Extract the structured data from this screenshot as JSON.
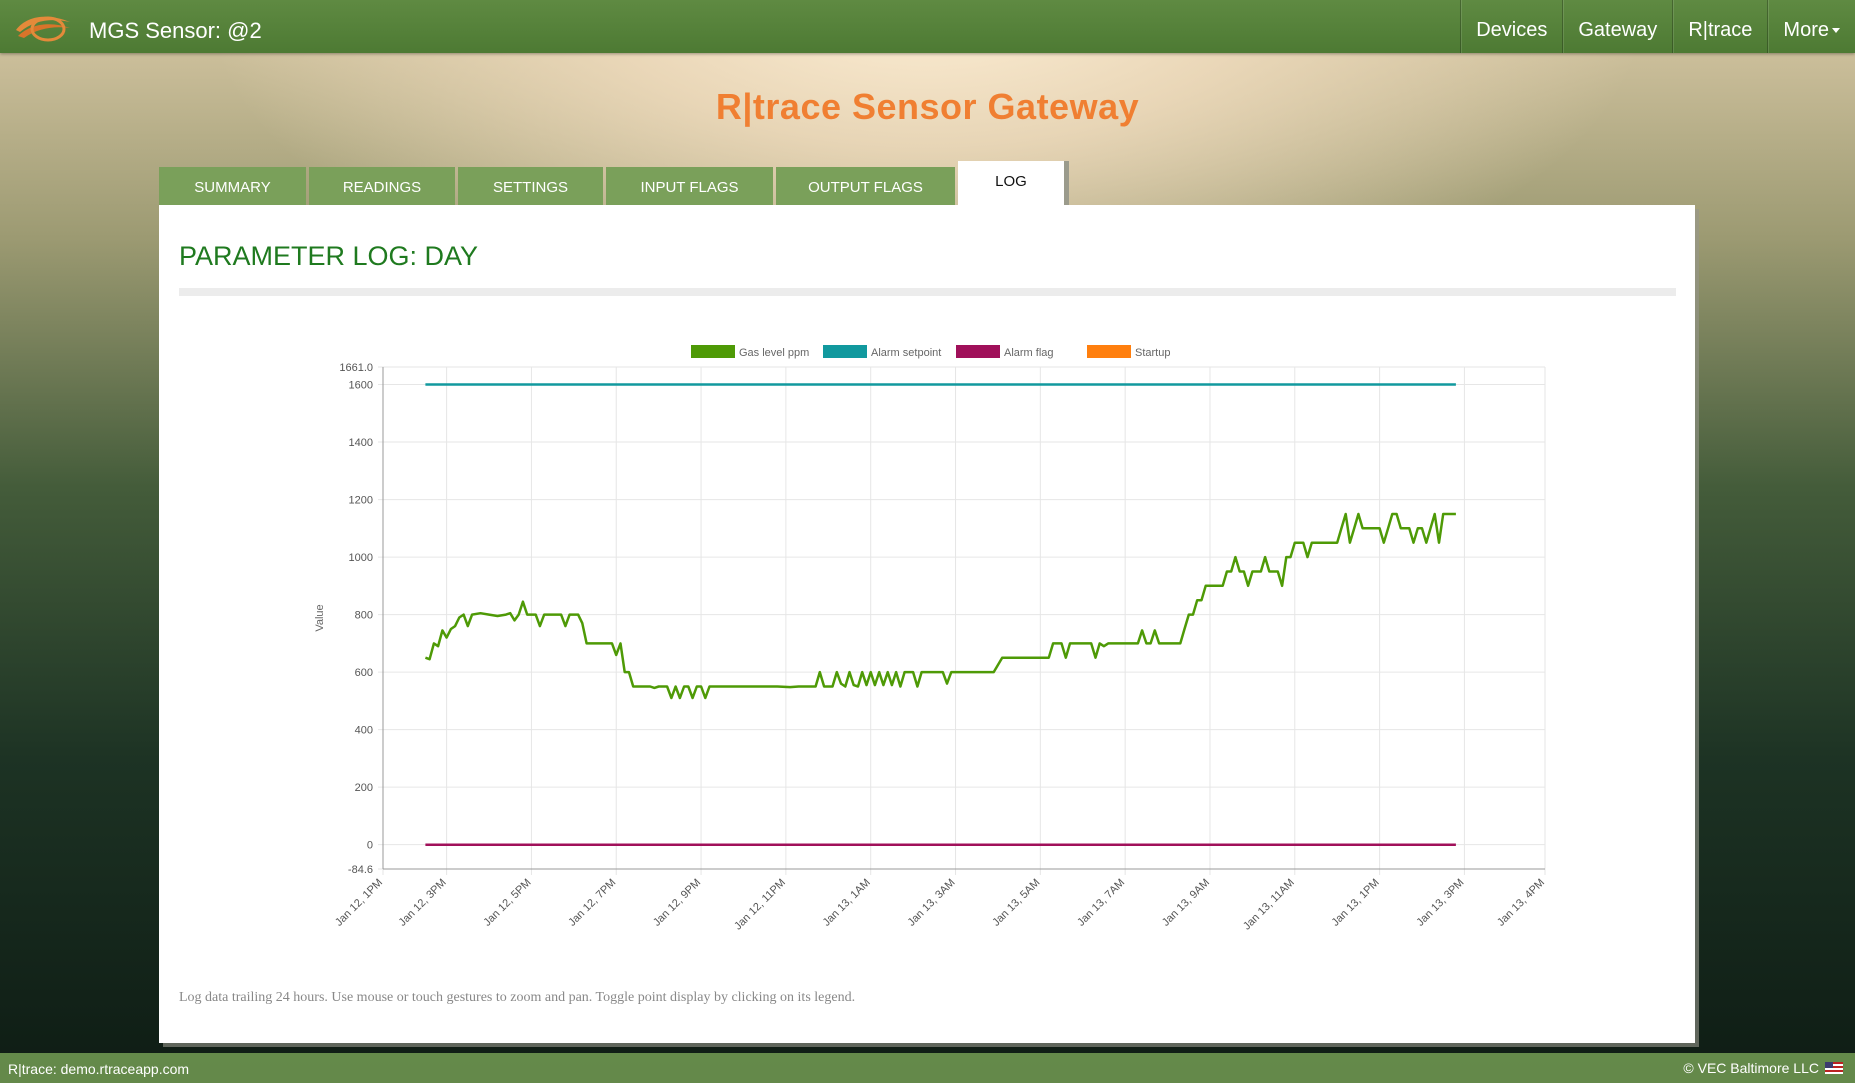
{
  "app": {
    "title": "MGS Sensor: @2",
    "nav": [
      {
        "label": "Devices"
      },
      {
        "label": "Gateway"
      },
      {
        "label": "R|trace"
      },
      {
        "label": "More"
      }
    ]
  },
  "page": {
    "heading": "R|trace Sensor Gateway",
    "tabs": [
      {
        "label": "SUMMARY",
        "active": false
      },
      {
        "label": "READINGS",
        "active": false
      },
      {
        "label": "SETTINGS",
        "active": false
      },
      {
        "label": "INPUT FLAGS",
        "active": false
      },
      {
        "label": "OUTPUT FLAGS",
        "active": false
      },
      {
        "label": "LOG",
        "active": true
      }
    ],
    "panel_title": "PARAMETER LOG: DAY",
    "footnote": "Log data trailing 24 hours. Use mouse or touch gestures to zoom and pan. Toggle point display by clicking on its legend."
  },
  "footer": {
    "left": "R|trace: demo.rtraceapp.com",
    "right": "© VEC Baltimore LLC"
  },
  "chart_data": {
    "type": "line",
    "ylabel": "Value",
    "ylim": [
      -84.6,
      1661.0
    ],
    "y_ticks": [
      {
        "value": 1661.0,
        "label": "1661.0"
      },
      {
        "value": 1600,
        "label": "1600"
      },
      {
        "value": 1400,
        "label": "1400"
      },
      {
        "value": 1200,
        "label": "1200"
      },
      {
        "value": 1000,
        "label": "1000"
      },
      {
        "value": 800,
        "label": "800"
      },
      {
        "value": 600,
        "label": "600"
      },
      {
        "value": 400,
        "label": "400"
      },
      {
        "value": 200,
        "label": "200"
      },
      {
        "value": 0,
        "label": "0"
      },
      {
        "value": -84.6,
        "label": "-84.6"
      }
    ],
    "x_ticks": [
      "Jan 12, 1PM",
      "Jan 12, 3PM",
      "Jan 12, 5PM",
      "Jan 12, 7PM",
      "Jan 12, 9PM",
      "Jan 12, 11PM",
      "Jan 13, 1AM",
      "Jan 13, 3AM",
      "Jan 13, 5AM",
      "Jan 13, 7AM",
      "Jan 13, 9AM",
      "Jan 13, 11AM",
      "Jan 13, 1PM",
      "Jan 13, 3PM",
      "Jan 13, 4PM"
    ],
    "x_tick_hours": [
      0,
      1.5,
      3.5,
      5.5,
      7.5,
      9.5,
      11.5,
      13.5,
      15.5,
      17.5,
      19.5,
      21.5,
      23.5,
      25.5,
      27.4
    ],
    "x_range_hours": [
      0,
      27.4
    ],
    "legend_position": "top-center",
    "grid": true,
    "series": [
      {
        "name": "Gas level ppm",
        "color": "#4e9a06",
        "points": [
          [
            1.0,
            650
          ],
          [
            1.1,
            645
          ],
          [
            1.2,
            700
          ],
          [
            1.3,
            690
          ],
          [
            1.4,
            745
          ],
          [
            1.5,
            720
          ],
          [
            1.6,
            750
          ],
          [
            1.7,
            760
          ],
          [
            1.8,
            790
          ],
          [
            1.9,
            800
          ],
          [
            2.0,
            760
          ],
          [
            2.1,
            800
          ],
          [
            2.3,
            805
          ],
          [
            2.5,
            800
          ],
          [
            2.7,
            795
          ],
          [
            2.9,
            800
          ],
          [
            3.0,
            805
          ],
          [
            3.1,
            780
          ],
          [
            3.2,
            800
          ],
          [
            3.3,
            845
          ],
          [
            3.4,
            800
          ],
          [
            3.6,
            800
          ],
          [
            3.7,
            760
          ],
          [
            3.8,
            800
          ],
          [
            4.0,
            800
          ],
          [
            4.2,
            800
          ],
          [
            4.3,
            760
          ],
          [
            4.4,
            800
          ],
          [
            4.6,
            800
          ],
          [
            4.7,
            770
          ],
          [
            4.8,
            700
          ],
          [
            5.0,
            700
          ],
          [
            5.2,
            700
          ],
          [
            5.4,
            700
          ],
          [
            5.5,
            660
          ],
          [
            5.6,
            700
          ],
          [
            5.7,
            600
          ],
          [
            5.8,
            600
          ],
          [
            5.9,
            550
          ],
          [
            6.1,
            550
          ],
          [
            6.3,
            550
          ],
          [
            6.4,
            545
          ],
          [
            6.5,
            550
          ],
          [
            6.7,
            550
          ],
          [
            6.8,
            510
          ],
          [
            6.9,
            550
          ],
          [
            7.0,
            510
          ],
          [
            7.1,
            550
          ],
          [
            7.2,
            550
          ],
          [
            7.3,
            510
          ],
          [
            7.4,
            550
          ],
          [
            7.5,
            550
          ],
          [
            7.6,
            510
          ],
          [
            7.7,
            550
          ],
          [
            7.8,
            550
          ],
          [
            8.0,
            550
          ],
          [
            8.3,
            550
          ],
          [
            8.6,
            550
          ],
          [
            9.0,
            550
          ],
          [
            9.3,
            550
          ],
          [
            9.6,
            548
          ],
          [
            9.8,
            550
          ],
          [
            10.0,
            550
          ],
          [
            10.2,
            550
          ],
          [
            10.3,
            600
          ],
          [
            10.4,
            550
          ],
          [
            10.6,
            550
          ],
          [
            10.7,
            600
          ],
          [
            10.8,
            560
          ],
          [
            10.9,
            550
          ],
          [
            11.0,
            600
          ],
          [
            11.1,
            555
          ],
          [
            11.2,
            550
          ],
          [
            11.3,
            600
          ],
          [
            11.4,
            555
          ],
          [
            11.5,
            600
          ],
          [
            11.6,
            555
          ],
          [
            11.7,
            600
          ],
          [
            11.8,
            555
          ],
          [
            11.9,
            600
          ],
          [
            12.0,
            555
          ],
          [
            12.1,
            600
          ],
          [
            12.2,
            550
          ],
          [
            12.3,
            600
          ],
          [
            12.5,
            600
          ],
          [
            12.6,
            550
          ],
          [
            12.7,
            600
          ],
          [
            12.9,
            600
          ],
          [
            13.1,
            600
          ],
          [
            13.2,
            600
          ],
          [
            13.3,
            560
          ],
          [
            13.4,
            600
          ],
          [
            13.6,
            600
          ],
          [
            13.9,
            600
          ],
          [
            14.2,
            600
          ],
          [
            14.4,
            600
          ],
          [
            14.6,
            650
          ],
          [
            14.9,
            650
          ],
          [
            15.2,
            650
          ],
          [
            15.6,
            650
          ],
          [
            15.7,
            650
          ],
          [
            15.8,
            700
          ],
          [
            16.0,
            700
          ],
          [
            16.1,
            650
          ],
          [
            16.2,
            700
          ],
          [
            16.5,
            700
          ],
          [
            16.7,
            700
          ],
          [
            16.8,
            650
          ],
          [
            16.9,
            700
          ],
          [
            17.0,
            690
          ],
          [
            17.1,
            700
          ],
          [
            17.4,
            700
          ],
          [
            17.7,
            700
          ],
          [
            17.8,
            700
          ],
          [
            17.9,
            745
          ],
          [
            18.0,
            700
          ],
          [
            18.1,
            700
          ],
          [
            18.2,
            745
          ],
          [
            18.3,
            700
          ],
          [
            18.5,
            700
          ],
          [
            18.8,
            700
          ],
          [
            18.9,
            750
          ],
          [
            19.0,
            800
          ],
          [
            19.1,
            800
          ],
          [
            19.2,
            850
          ],
          [
            19.3,
            850
          ],
          [
            19.4,
            900
          ],
          [
            19.6,
            900
          ],
          [
            19.8,
            900
          ],
          [
            19.9,
            950
          ],
          [
            20.0,
            950
          ],
          [
            20.1,
            1000
          ],
          [
            20.2,
            950
          ],
          [
            20.3,
            950
          ],
          [
            20.4,
            900
          ],
          [
            20.5,
            950
          ],
          [
            20.7,
            950
          ],
          [
            20.8,
            1000
          ],
          [
            20.9,
            950
          ],
          [
            21.0,
            950
          ],
          [
            21.1,
            950
          ],
          [
            21.2,
            900
          ],
          [
            21.3,
            1000
          ],
          [
            21.4,
            1000
          ],
          [
            21.5,
            1050
          ],
          [
            21.7,
            1050
          ],
          [
            21.8,
            1000
          ],
          [
            21.9,
            1050
          ],
          [
            22.1,
            1050
          ],
          [
            22.4,
            1050
          ],
          [
            22.5,
            1050
          ],
          [
            22.6,
            1100
          ],
          [
            22.7,
            1150
          ],
          [
            22.8,
            1050
          ],
          [
            22.9,
            1100
          ],
          [
            23.0,
            1150
          ],
          [
            23.1,
            1100
          ],
          [
            23.3,
            1100
          ],
          [
            23.5,
            1100
          ],
          [
            23.6,
            1050
          ],
          [
            23.7,
            1100
          ],
          [
            23.8,
            1150
          ],
          [
            23.9,
            1150
          ],
          [
            24.0,
            1100
          ],
          [
            24.1,
            1100
          ],
          [
            24.2,
            1100
          ],
          [
            24.3,
            1050
          ],
          [
            24.4,
            1100
          ],
          [
            24.5,
            1100
          ],
          [
            24.6,
            1050
          ],
          [
            24.7,
            1100
          ],
          [
            24.8,
            1150
          ],
          [
            24.9,
            1050
          ],
          [
            25.0,
            1150
          ],
          [
            25.1,
            1150
          ],
          [
            25.3,
            1150
          ]
        ]
      },
      {
        "name": "Alarm setpoint",
        "color": "#11999e",
        "points": [
          [
            1.0,
            1600
          ],
          [
            25.3,
            1600
          ]
        ]
      },
      {
        "name": "Alarm flag",
        "color": "#a0105a",
        "points": [
          [
            1.0,
            0
          ],
          [
            25.3,
            0
          ]
        ]
      },
      {
        "name": "Startup",
        "color": "#ff7f0e",
        "points": []
      }
    ]
  }
}
